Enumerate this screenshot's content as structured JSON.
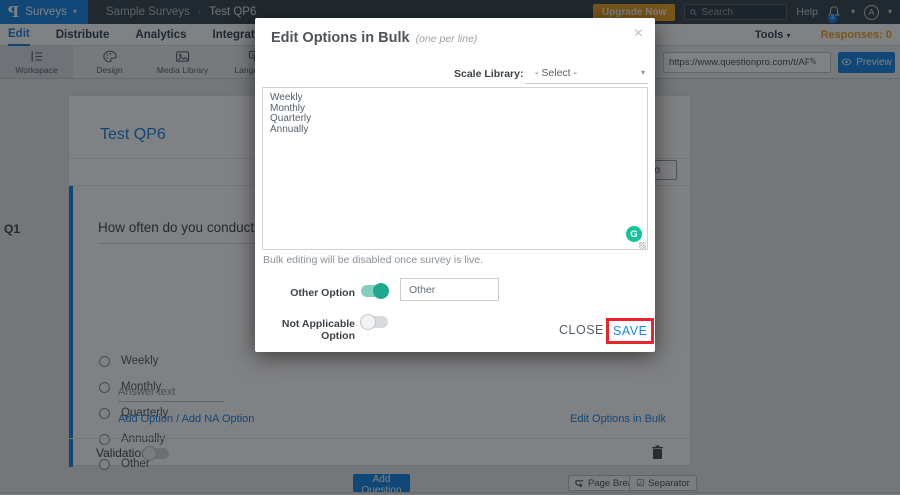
{
  "topbar": {
    "logo": "P",
    "product": "Surveys",
    "breadcrumb_parent": "Sample Surveys",
    "breadcrumb_sep": "›",
    "breadcrumb_current": "Test QP6",
    "upgrade_label": "Upgrade Now",
    "search_placeholder": "Search",
    "help_label": "Help",
    "notification_count": "3",
    "avatar_initial": "A",
    "caret": "▾"
  },
  "menubar": {
    "items": [
      "Edit",
      "Distribute",
      "Analytics",
      "Integration"
    ],
    "tools_label": "Tools",
    "responses_label": "Responses: 0",
    "caret": "▾"
  },
  "toolbar": {
    "tabs": [
      "Workspace",
      "Design",
      "Media Library",
      "Languages"
    ],
    "url_value": "https://www.questionpro.com/t/APNrfZ",
    "pencil": "✎",
    "preview_label": "Preview"
  },
  "survey": {
    "qnum": "Q1",
    "title": "Test QP6",
    "intro_button": "Intro",
    "question_text": "How often do you conduct the",
    "options": [
      "Weekly",
      "Monthly",
      "Quarterly",
      "Annually",
      "Other"
    ],
    "answer_placeholder": "Answer text",
    "add_option_link": "Add Option / Add NA Option",
    "edit_bulk_link": "Edit Options in Bulk",
    "validation_label": "Validation",
    "add_question_label": "Add Question",
    "page_break_label": "Page Break",
    "separator_label": "Separator",
    "separator_icon_glyph": "☑"
  },
  "modal": {
    "title": "Edit Options in Bulk",
    "subtitle": "(one per line)",
    "close_x": "×",
    "scale_library_label": "Scale Library:",
    "scale_library_value": "- Select -",
    "caret": "▾",
    "options_text": "Weekly\nMonthly\nQuarterly\nAnnually",
    "grammarly_glyph": "G",
    "note": "Bulk editing will be disabled once survey is live.",
    "other_option_label": "Other Option",
    "other_option_value": "Other",
    "na_option_label": "Not Applicable Option",
    "close_label": "CLOSE",
    "save_label": "SAVE"
  },
  "colors": {
    "accent_blue": "#1b87e6",
    "orange": "#f5a623",
    "toggle_on_teal": "#1fa98c",
    "grammarly_green": "#15c39a",
    "annotation_red": "#e8252d"
  }
}
